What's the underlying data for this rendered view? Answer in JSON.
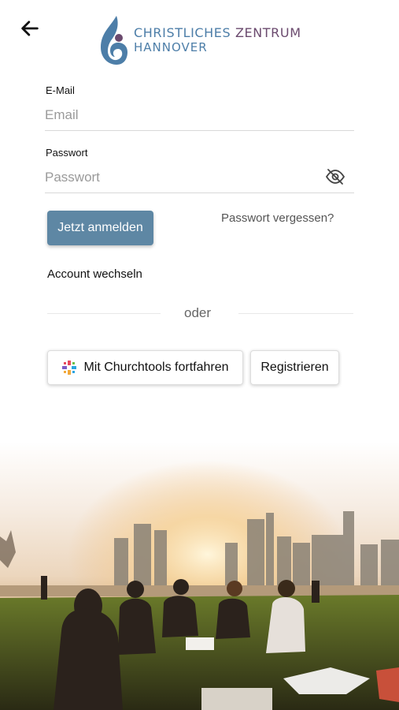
{
  "logo": {
    "line1_a": "CHRISTLICHES",
    "line1_b": "ZENTRUM",
    "line2": "HANNOVER"
  },
  "form": {
    "email_label": "E-Mail",
    "email_placeholder": "Email",
    "password_label": "Passwort",
    "password_placeholder": "Passwort"
  },
  "actions": {
    "login": "Jetzt anmelden",
    "forgot": "Passwort vergessen?",
    "switch_account": "Account wechseln",
    "divider": "oder",
    "churchtools": "Mit Churchtools fortfahren",
    "register": "Registrieren"
  },
  "colors": {
    "primary": "#5e87a4",
    "logo_blue": "#4d7ea8",
    "logo_purple": "#6b4a6e"
  }
}
